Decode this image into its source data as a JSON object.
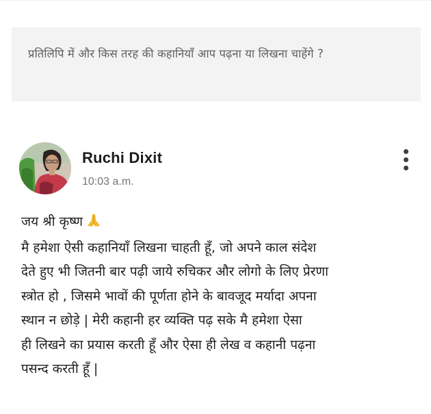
{
  "question": {
    "text": "प्रतिलिपि में और किस तरह की कहानियाँ आप पढ़ना या लिखना चाहेंगे ?"
  },
  "post": {
    "author": "Ruchi Dixit",
    "time": "10:03 a.m.",
    "avatar_icon": "profile-photo",
    "menu_icon": "more-vertical-icon",
    "greeting": "जय श्री कृष्ण",
    "greeting_emoji": "folded-hands-emoji",
    "lines": [
      "मै हमेशा ऐसी कहानियाँ लिखना चाहती हूँ, जो अपने काल संदेश",
      "देते हुए भी जितनी बार पढ़ी जाये रुचिकर और लोगो के लिए प्रेरणा",
      "स्त्रोत हो , जिसमे भावों की पूर्णता होने के बावजूद मर्यादा अपना",
      "स्थान न छोड़े | मेरी कहानी हर व्यक्ति पढ़ सके मै हमेशा ऐसा",
      "ही लिखने का प्रयास करती हूँ और ऐसा ही लेख व कहानी पढ़ना",
      "पसन्द करती हूँ |"
    ]
  },
  "colors": {
    "question_bg": "#f3f3f3",
    "question_text": "#5d5d5d",
    "body_text": "#1e1e1e",
    "time_text": "#757575"
  }
}
